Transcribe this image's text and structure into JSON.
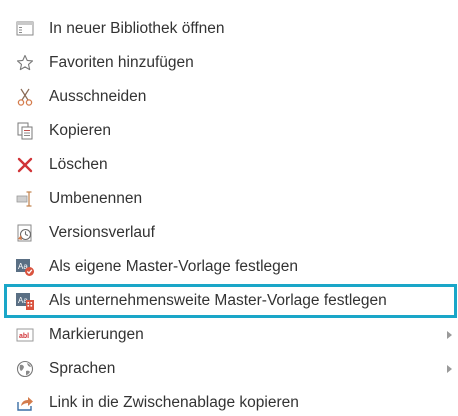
{
  "menu": {
    "items": [
      {
        "label": "In neuer Bibliothek öffnen",
        "icon": "library-window-icon"
      },
      {
        "label": "Favoriten hinzufügen",
        "icon": "star-icon"
      },
      {
        "label": "Ausschneiden",
        "icon": "scissors-icon"
      },
      {
        "label": "Kopieren",
        "icon": "copy-icon"
      },
      {
        "label": "Löschen",
        "icon": "delete-x-icon"
      },
      {
        "label": "Umbenennen",
        "icon": "rename-icon"
      },
      {
        "label": "Versionsverlauf",
        "icon": "version-history-icon"
      },
      {
        "label": "Als eigene Master-Vorlage festlegen",
        "icon": "master-template-personal-icon"
      },
      {
        "label": "Als unternehmensweite Master-Vorlage festlegen",
        "icon": "master-template-company-icon",
        "highlighted": true
      },
      {
        "label": "Markierungen",
        "icon": "tags-icon",
        "submenu": true
      },
      {
        "label": "Sprachen",
        "icon": "globe-icon",
        "submenu": true
      },
      {
        "label": "Link in die Zwischenablage kopieren",
        "icon": "share-link-icon"
      }
    ]
  },
  "colors": {
    "highlight_border": "#1aa6c8",
    "delete_red": "#d13438",
    "text": "#333333"
  }
}
